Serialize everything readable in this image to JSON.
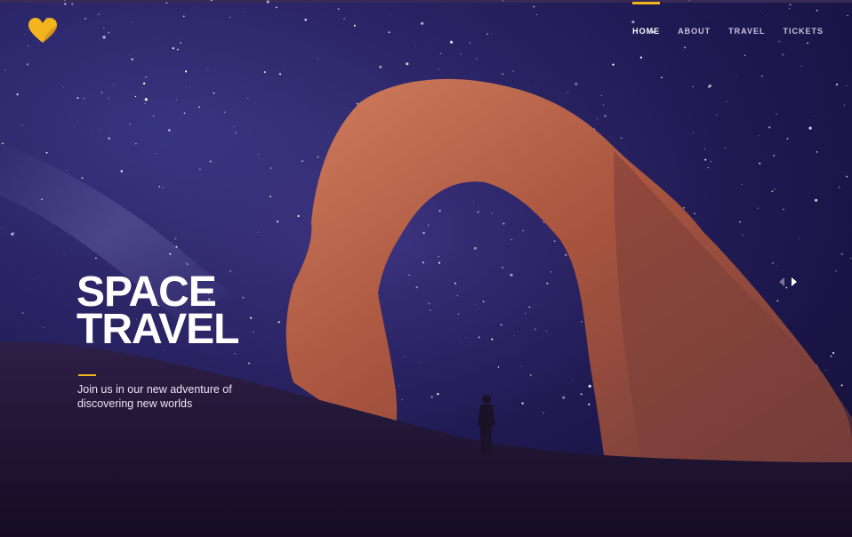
{
  "nav": {
    "items": [
      {
        "label": "HOME",
        "active": true
      },
      {
        "label": "ABOUT",
        "active": false
      },
      {
        "label": "TRAVEL",
        "active": false
      },
      {
        "label": "TICKETS",
        "active": false
      }
    ]
  },
  "hero": {
    "title_line1": "SPACE",
    "title_line2": "TRAVEL",
    "subtitle": "Join us in our new adventure of discovering new worlds"
  },
  "icons": {
    "logo": "heart-logo-icon",
    "prev": "chevron-left-icon",
    "next": "chevron-right-icon"
  },
  "colors": {
    "accent": "#f2b51e",
    "sky": "#2a2466",
    "arch": "#b55a45",
    "ground": "#1e1432"
  }
}
